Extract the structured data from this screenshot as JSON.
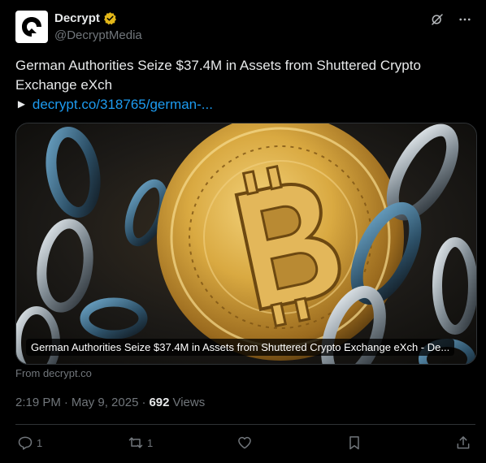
{
  "author": {
    "display_name": "Decrypt",
    "handle": "@DecryptMedia",
    "verified_color": "#e2b719"
  },
  "tweet": {
    "text": "German Authorities Seize $37.4M in Assets from Shuttered Crypto Exchange eXch",
    "link_prefix": "►",
    "link_text": "decrypt.co/318765/german-..."
  },
  "card": {
    "caption": "German Authorities Seize $37.4M in Assets from Shuttered Crypto Exchange eXch - De...",
    "source": "From decrypt.co"
  },
  "meta": {
    "time": "2:19 PM",
    "separator": "·",
    "date": "May 9, 2025",
    "separator2": "·",
    "views_count": "692",
    "views_label": "Views"
  },
  "actions": {
    "reply_count": "1",
    "repost_count": "1"
  },
  "icons": {
    "header": [
      "grok-icon",
      "more-icon"
    ],
    "actions": [
      "reply-icon",
      "repost-icon",
      "like-icon",
      "bookmark-icon",
      "share-icon"
    ]
  },
  "colors": {
    "background": "#000000",
    "link": "#1d9bf0",
    "muted": "#71767b",
    "text": "#e7e9ea"
  }
}
